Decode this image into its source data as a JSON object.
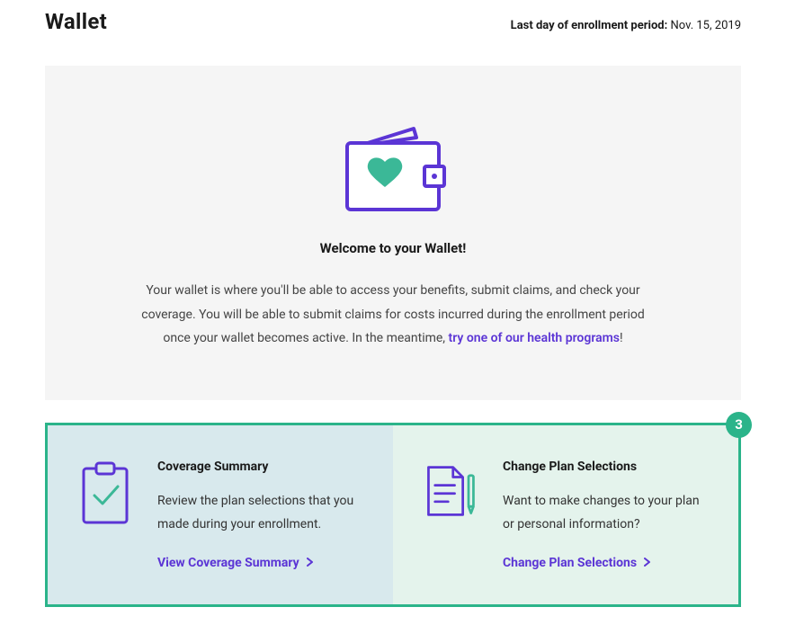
{
  "header": {
    "title": "Wallet",
    "enrollment_label": "Last day of enrollment period:",
    "enrollment_date": "Nov. 15, 2019"
  },
  "welcome": {
    "title": "Welcome to your Wallet!",
    "body_prefix": "Your wallet is where you'll be able to access your benefits, submit claims, and check your coverage. You will be able to submit claims for costs incurred during the enrollment period once your wallet becomes active. In the meantime, ",
    "link_text": "try one of our health programs",
    "body_suffix": "!"
  },
  "badge": "3",
  "cards": {
    "coverage": {
      "title": "Coverage Summary",
      "desc": "Review the plan selections that you made during your enrollment.",
      "link": "View Coverage Summary"
    },
    "change": {
      "title": "Change Plan Selections",
      "desc": "Want to make changes to your plan or personal information?",
      "link": "Change Plan Selections"
    }
  },
  "colors": {
    "accent_purple": "#5b35d5",
    "accent_green": "#2bb48a"
  }
}
